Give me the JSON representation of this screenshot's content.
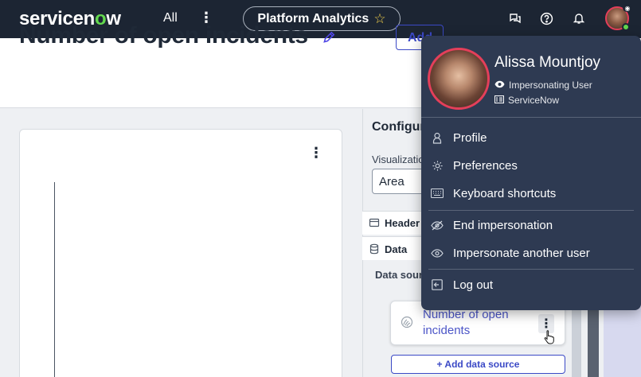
{
  "topnav": {
    "logo": "servicenow",
    "all_label": "All",
    "more_label": "⋮",
    "workspace_label": "Platform Analytics",
    "icons": [
      "chat-icon",
      "help-icon",
      "bell-icon",
      "avatar"
    ]
  },
  "header": {
    "title": "Number of open incidents",
    "add_button_label": "Add"
  },
  "chart_card": {
    "menu_label": "⋮"
  },
  "config": {
    "title": "Configuration",
    "visualization_label": "Visualization",
    "visualization_value": "Area",
    "sections": [
      {
        "label": "Header and title"
      },
      {
        "label": "Data"
      }
    ],
    "data_sources_label": "Data sources",
    "data_source_name": "Number of open incidents",
    "data_source_menu": "⋮",
    "add_data_source_label": "+ Add data source"
  },
  "user_menu": {
    "name": "Alissa Mountjoy",
    "status": "Impersonating User",
    "company": "ServiceNow",
    "items": [
      {
        "label": "Profile",
        "icon": "person-icon"
      },
      {
        "label": "Preferences",
        "icon": "gear-icon"
      },
      {
        "label": "Keyboard shortcuts",
        "icon": "keyboard-icon"
      },
      {
        "label": "End impersonation",
        "icon": "eye-off-icon"
      },
      {
        "label": "Impersonate another user",
        "icon": "eye-icon"
      },
      {
        "label": "Log out",
        "icon": "logout-icon"
      }
    ]
  },
  "colors": {
    "nav_bg": "#1c2533",
    "menu_bg": "#2e3a52",
    "accent": "#3b49c6",
    "avatar_ring": "#e43f5a",
    "logo_green": "#62d84e"
  }
}
